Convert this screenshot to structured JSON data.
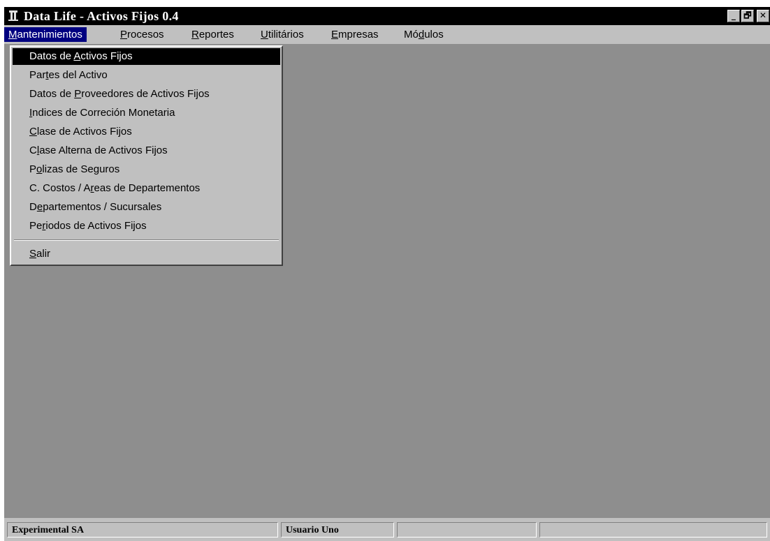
{
  "window": {
    "title": "Data Life - Activos Fijos 0.4",
    "controls": {
      "minimize": "_",
      "restore": "🗗",
      "close": "✕"
    }
  },
  "menubar": [
    {
      "pre": "",
      "key": "M",
      "post": "antenimientos"
    },
    {
      "pre": "",
      "key": "P",
      "post": "rocesos"
    },
    {
      "pre": "",
      "key": "R",
      "post": "eportes"
    },
    {
      "pre": "",
      "key": "U",
      "post": "tilitários"
    },
    {
      "pre": "",
      "key": "E",
      "post": "mpresas"
    },
    {
      "pre": "Mó",
      "key": "d",
      "post": "ulos"
    }
  ],
  "dropdown": {
    "items": [
      {
        "pre": "Datos de ",
        "key": "A",
        "post": "ctivos Fijos"
      },
      {
        "pre": "Par",
        "key": "t",
        "post": "es del Activo"
      },
      {
        "pre": "Datos de ",
        "key": "P",
        "post": "roveedores de Activos Fijos"
      },
      {
        "pre": "",
        "key": "I",
        "post": "ndices de Correción Monetaria"
      },
      {
        "pre": "",
        "key": "C",
        "post": "lase de Activos Fijos"
      },
      {
        "pre": "C",
        "key": "l",
        "post": "ase Alterna de Activos Fijos"
      },
      {
        "pre": "P",
        "key": "o",
        "post": "lizas de Seguros"
      },
      {
        "pre": "C. Costos / A",
        "key": "r",
        "post": "eas de Departementos"
      },
      {
        "pre": "D",
        "key": "e",
        "post": "partementos / Sucursales"
      },
      {
        "pre": "Pe",
        "key": "r",
        "post": "iodos de Activos Fijos"
      }
    ],
    "exit": {
      "pre": "",
      "key": "S",
      "post": "alir"
    }
  },
  "statusbar": {
    "company": "Experimental SA",
    "user": "Usuario Uno",
    "panel3": "",
    "panel4": ""
  }
}
